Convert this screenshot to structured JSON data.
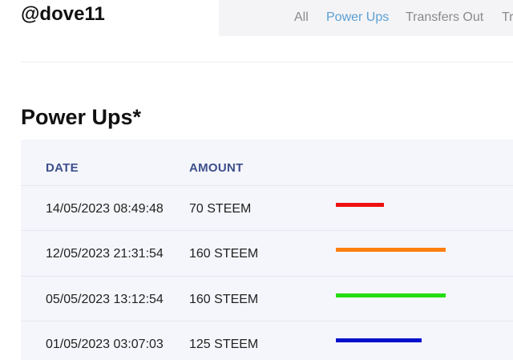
{
  "header": {
    "username": "@dove11"
  },
  "nav": {
    "items": [
      {
        "label": "All",
        "active": false
      },
      {
        "label": "Power Ups",
        "active": true
      },
      {
        "label": "Transfers Out",
        "active": false
      },
      {
        "label": "Tr",
        "active": false
      }
    ]
  },
  "section": {
    "title": "Power Ups*"
  },
  "table": {
    "headers": {
      "date": "DATE",
      "amount": "AMOUNT"
    },
    "rows": [
      {
        "date": "14/05/2023 08:49:48",
        "amount": "70 STEEM",
        "value": 70,
        "bar_color": "#ee1111"
      },
      {
        "date": "12/05/2023 21:31:54",
        "amount": "160 STEEM",
        "value": 160,
        "bar_color": "#ff7f0e"
      },
      {
        "date": "05/05/2023 13:12:54",
        "amount": "160 STEEM",
        "value": 160,
        "bar_color": "#22dd11"
      },
      {
        "date": "01/05/2023 03:07:03",
        "amount": "125 STEEM",
        "value": 125,
        "bar_color": "#0011cc"
      }
    ]
  }
}
